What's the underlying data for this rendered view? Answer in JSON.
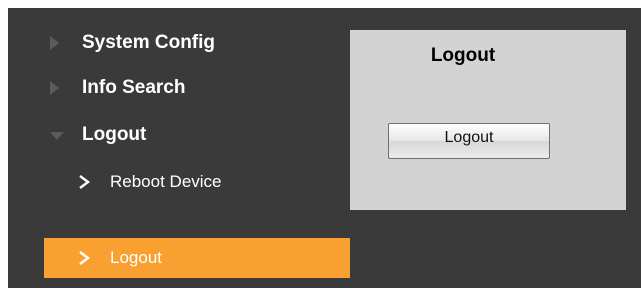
{
  "sidebar": {
    "groups": [
      {
        "label": "System Config",
        "icon": "caret-right-icon",
        "expanded": false
      },
      {
        "label": "Info Search",
        "icon": "caret-right-icon",
        "expanded": false
      },
      {
        "label": "Logout",
        "icon": "caret-down-icon",
        "expanded": true
      }
    ],
    "subitems": [
      {
        "label": "Reboot Device",
        "icon": "chevron-right-icon",
        "active": false
      },
      {
        "label": "Logout",
        "icon": "chevron-right-icon",
        "active": true
      }
    ]
  },
  "content": {
    "tab_label": "Logout",
    "logout_button": "Logout"
  },
  "colors": {
    "sidebar_bg": "#3a3a3a",
    "active_item": "#f9a130",
    "panel_bg": "#d3d3d3"
  }
}
